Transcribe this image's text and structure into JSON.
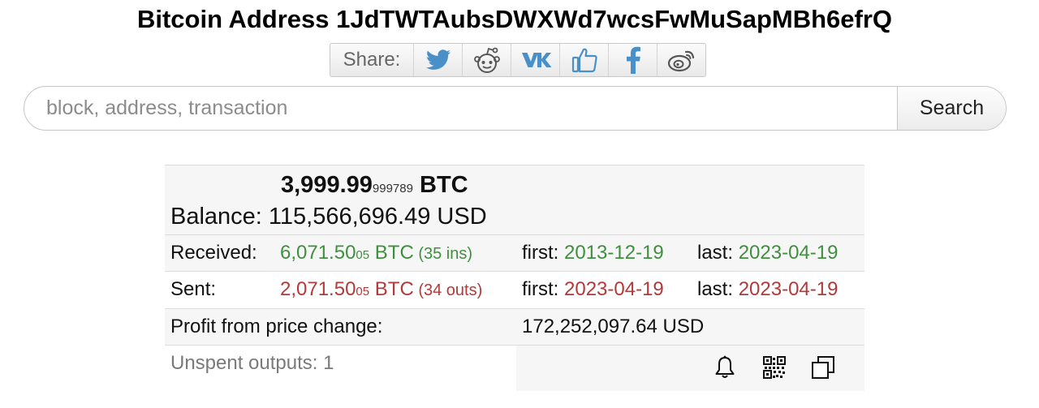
{
  "page": {
    "title": "Bitcoin Address 1JdTWTAubsDWXWd7wcsFwMuSapMBh6efrQ"
  },
  "share": {
    "label": "Share:",
    "buttons": [
      "twitter-icon",
      "reddit-icon",
      "vk-icon",
      "like-icon",
      "facebook-icon",
      "weibo-icon"
    ],
    "icon_color": "#4a90c8"
  },
  "search": {
    "placeholder": "block, address, transaction",
    "value": "",
    "button_label": "Search"
  },
  "balance": {
    "btc_main": "3,999.99",
    "btc_small": "999789",
    "btc_unit": " BTC",
    "label": "Balance:",
    "usd": "115,566,696.49 USD"
  },
  "received": {
    "label": "Received:",
    "amount_main": "6,071.50",
    "amount_small": "05",
    "unit": " BTC",
    "count": " (35 ins)",
    "first_label": "first:",
    "first": "2013-12-19",
    "last_label": "last:",
    "last": "2023-04-19",
    "color": "#3f8f3f"
  },
  "sent": {
    "label": "Sent:",
    "amount_main": "2,071.50",
    "amount_small": "05",
    "unit": " BTC",
    "count": " (34 outs)",
    "first_label": "first:",
    "first": "2023-04-19",
    "last_label": "last:",
    "last": "2023-04-19",
    "color": "#b23a3a"
  },
  "profit": {
    "label": "Profit from price change:",
    "value": "172,252,097.64 USD"
  },
  "unspent": {
    "label": "Unspent outputs: 1",
    "actions": [
      "bell-icon",
      "qr-code-icon",
      "copy-icon"
    ]
  }
}
